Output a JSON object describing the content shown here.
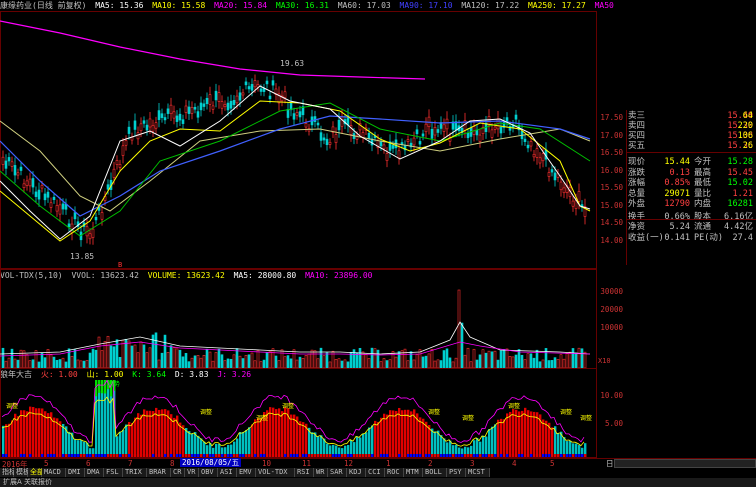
{
  "main_header": {
    "title": "康缘药业(日线 前复权)",
    "ma5": "MA5: 15.36",
    "ma10": "MA10: 15.58",
    "ma20": "MA20: 15.84",
    "ma30": "MA30: 16.31",
    "ma60": "MA60: 17.03",
    "ma90": "MA90: 17.10",
    "ma120": "MA120: 17.22",
    "ma250": "MA250: 17.27",
    "ma50": "MA50"
  },
  "annotations": {
    "high": "19.63",
    "low": "13.85",
    "red_marker": "B"
  },
  "price_axis": [
    "17.50",
    "17.00",
    "16.50",
    "16.00",
    "15.50",
    "15.00",
    "14.50",
    "14.00"
  ],
  "quotes_partial": [
    {
      "k": "卖三",
      "v": "15.40",
      "n": "64"
    },
    {
      "k": "卖四",
      "v": "15.39",
      "n": "220"
    },
    {
      "k": "买四",
      "v": "15.38",
      "n": "106"
    },
    {
      "k": "买五",
      "v": "15.36",
      "n": "26"
    }
  ],
  "quote_table": [
    {
      "k1": "现价",
      "v1": "15.44",
      "k2": "今开",
      "v2": "15.28",
      "c1": "#ffff00",
      "c2": "#00ff00"
    },
    {
      "k1": "涨跌",
      "v1": "0.13",
      "k2": "最高",
      "v2": "15.45",
      "c1": "#ff4040",
      "c2": "#ff4040"
    },
    {
      "k1": "涨幅",
      "v1": "0.85%",
      "k2": "最低",
      "v2": "15.02",
      "c1": "#ff4040",
      "c2": "#00ff00"
    },
    {
      "k1": "总量",
      "v1": "29071",
      "k2": "量比",
      "v2": "1.21",
      "c1": "#ffff00",
      "c2": "#ff4040"
    },
    {
      "k1": "外盘",
      "v1": "12790",
      "k2": "内盘",
      "v2": "16281",
      "c1": "#ff4040",
      "c2": "#00ff00"
    },
    {
      "k1": "换手",
      "v1": "0.66%",
      "k2": "股本",
      "v2": "6.16亿",
      "c1": "#c0c0c0",
      "c2": "#c0c0c0"
    },
    {
      "k1": "净资",
      "v1": "5.24",
      "k2": "流通",
      "v2": "4.42亿",
      "c1": "#c0c0c0",
      "c2": "#c0c0c0"
    },
    {
      "k1": "收益(一)",
      "v1": "0.141",
      "k2": "PE(动)",
      "v2": "27.4",
      "c1": "#c0c0c0",
      "c2": "#c0c0c0"
    }
  ],
  "vol_header": {
    "name": "VOL-TDX(5,10)",
    "vvol": "VVOL: 13623.42",
    "volume": "VOLUME: 13623.42",
    "ma5": "MA5: 28000.80",
    "ma10": "MA10: 23896.00"
  },
  "vol_axis": [
    "30000",
    "20000",
    "10000"
  ],
  "vol_unit": "X10",
  "ind_header": {
    "name": "狼年大吉",
    "fire": "火: 1.00",
    "mountain": "山: 1.00",
    "k": "K: 3.64",
    "d": "D: 3.83",
    "j": "J: 3.26"
  },
  "ind_axis": [
    "10.00",
    "5.00"
  ],
  "ind_markers": [
    "调整",
    "调整",
    "调整",
    "调整",
    "调整",
    "调整",
    "调整",
    "调整",
    "调整"
  ],
  "ind_peak_label": "转势",
  "time_axis": {
    "year": "2016年",
    "months": [
      "5",
      "6",
      "7",
      "8",
      "9",
      "10",
      "11",
      "12",
      "1",
      "2",
      "3",
      "4",
      "5"
    ],
    "cursor_date": "2016/08/05/五",
    "right_label": "日"
  },
  "tabs": [
    "指标",
    "模板",
    "全部",
    "MACD",
    "DMI",
    "DMA",
    "FSL",
    "TRIX",
    "BRAR",
    "CR",
    "VR",
    "OBV",
    "ASI",
    "EMV",
    "VOL-TDX",
    "RSI",
    "WR",
    "SAR",
    "KDJ",
    "CCI",
    "ROC",
    "MTM",
    "BOLL",
    "PSY",
    "MCST"
  ],
  "bottom_text": "扩展A  关联报价",
  "chart_data": [
    {
      "type": "line",
      "title": "康缘药业(日线 前复权)",
      "series": [
        {
          "name": "MA250",
          "values": [
            19.0,
            18.9,
            18.8,
            18.7,
            18.5,
            18.3,
            18.1
          ]
        },
        {
          "name": "MA120",
          "values": [
            14.6,
            14.4,
            15.0,
            16.8,
            17.3,
            17.6,
            17.2
          ]
        },
        {
          "name": "MA60",
          "values": [
            15.6,
            14.5,
            15.1,
            17.1,
            17.5,
            17.6,
            17.0
          ]
        }
      ],
      "x": [
        "2016-05",
        "2016-06",
        "2016-07",
        "2016-08",
        "2016-10",
        "2017-01",
        "2017-05"
      ],
      "ylim": [
        13.8,
        20.0
      ],
      "annotations": [
        {
          "label": "19.63"
        },
        {
          "label": "13.85"
        }
      ]
    },
    {
      "type": "bar",
      "title": "VOL-TDX(5,10)",
      "ylim": [
        0,
        35000
      ]
    },
    {
      "type": "bar",
      "title": "狼年大吉",
      "ylim": [
        0,
        12
      ]
    }
  ],
  "colors": {
    "up": "#ff3030",
    "down": "#00d0d0",
    "ma5": "#ffffff",
    "ma10": "#ffff00",
    "ma20": "#ff00ff",
    "ma30": "#00ff00",
    "ma60": "#8080ff",
    "ma120": "#0000ff",
    "ma250": "#ff00ff"
  }
}
